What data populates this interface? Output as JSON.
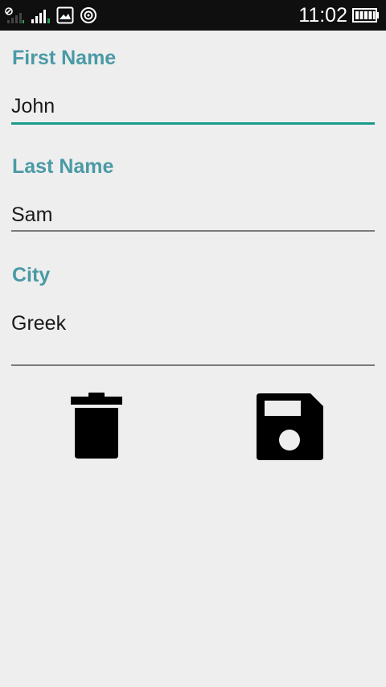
{
  "status_bar": {
    "time": "11:02",
    "icons": [
      "no-sim-icon",
      "signal-icon",
      "signal-icon",
      "image-notification-icon",
      "sync-icon",
      "battery-icon"
    ]
  },
  "form": {
    "first_name": {
      "label": "First Name",
      "value": "John"
    },
    "last_name": {
      "label": "Last Name",
      "value": "Sam"
    },
    "city": {
      "label": "City",
      "value": "Greek"
    }
  },
  "colors": {
    "label": "#4a9aa6",
    "active_underline": "#1a9a8c",
    "underline": "#7a7a7a",
    "background": "#eeeeee",
    "status_bar": "#0f0f0f"
  },
  "actions": {
    "delete_icon": "trash-icon",
    "save_icon": "floppy-disk-icon"
  }
}
